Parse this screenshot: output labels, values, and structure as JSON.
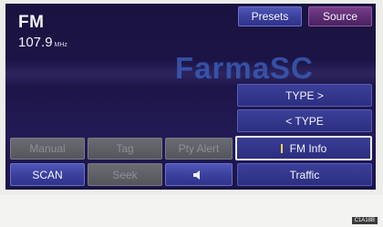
{
  "radio": {
    "mode": "FM",
    "frequency": "107.9",
    "unit": "MHz"
  },
  "header": {
    "presets_label": "Presets",
    "source_label": "Source"
  },
  "side_menu": {
    "type_next_label": "TYPE >",
    "type_prev_label": "< TYPE",
    "fm_info_label": "FM Info",
    "traffic_label": "Traffic"
  },
  "bottom_row1": {
    "button1_label": "Manual",
    "button2_label": "Tag",
    "button3_label": "Pty Alert"
  },
  "bottom_row2": {
    "scan_label": "SCAN",
    "seek_label": "Seek",
    "mute_icon": "speaker-icon"
  },
  "watermark": "FarmaSC",
  "image_code": "C1A18B"
}
